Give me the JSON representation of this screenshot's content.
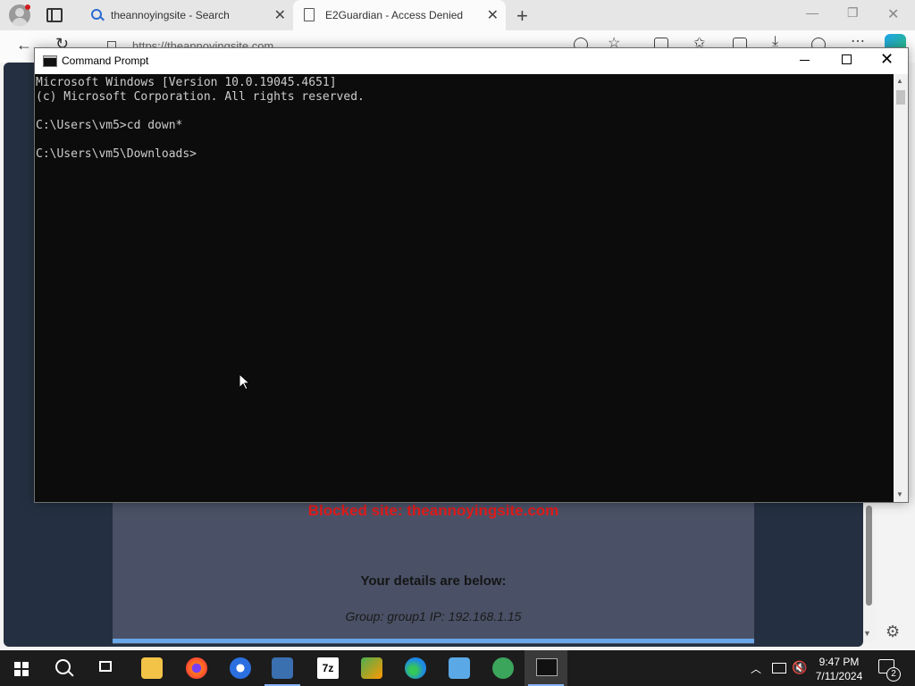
{
  "browser": {
    "tabs": [
      {
        "label": "theannoyingsite - Search"
      },
      {
        "label": "E2Guardian - Access Denied"
      }
    ],
    "address": "https://theannoyingsite.com"
  },
  "page": {
    "blocked_text": "Blocked site: theannoyingsite.com",
    "details_heading": "Your details are below:",
    "details_line": "Group: group1    IP: 192.168.1.15"
  },
  "cmd": {
    "title": "Command Prompt",
    "lines": [
      "Microsoft Windows [Version 10.0.19045.4651]",
      "(c) Microsoft Corporation. All rights reserved.",
      "",
      "C:\\Users\\vm5>cd down*",
      "",
      "C:\\Users\\vm5\\Downloads>"
    ]
  },
  "taskbar": {
    "time": "9:47 PM",
    "date": "7/11/2024",
    "notification_count": "2",
    "sevenzip_label": "7z"
  },
  "colors": {
    "console_bg": "#0c0c0c",
    "console_text": "#cccccc",
    "blocked_red": "#e11b1b",
    "taskbar_bg": "#1c1c1c"
  }
}
